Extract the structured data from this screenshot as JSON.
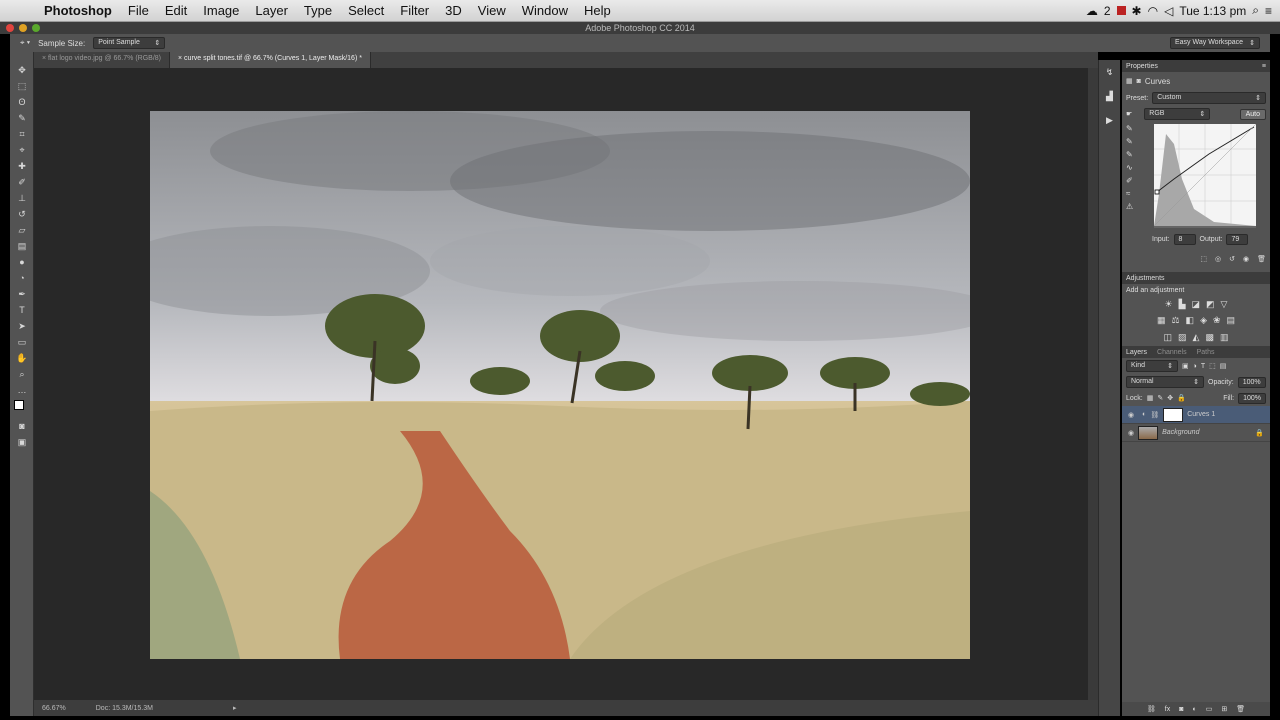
{
  "menubar": {
    "app": "Photoshop",
    "items": [
      "File",
      "Edit",
      "Image",
      "Layer",
      "Type",
      "Select",
      "Filter",
      "3D",
      "View",
      "Window",
      "Help"
    ],
    "clock": "Tue 1:13 pm",
    "badge": "2"
  },
  "window": {
    "title": "Adobe Photoshop CC 2014"
  },
  "options": {
    "sample_label": "Sample Size:",
    "sample_value": "Point Sample",
    "workspace": "Easy Way Workspace"
  },
  "tabs": [
    {
      "label": "flat logo video.jpg @ 66.7% (RGB/8)"
    },
    {
      "label": "curve split tones.tif @ 66.7% (Curves 1, Layer Mask/16) *"
    }
  ],
  "status": {
    "zoom": "66.67%",
    "doc": "Doc: 15.3M/15.3M"
  },
  "properties": {
    "header": "Properties",
    "title": "Curves",
    "preset_label": "Preset:",
    "preset_value": "Custom",
    "channel": "RGB",
    "auto_label": "Auto",
    "input_label": "Input:",
    "input_value": "8",
    "output_label": "Output:",
    "output_value": "79"
  },
  "adjustments": {
    "header": "Adjustments",
    "add_label": "Add an adjustment"
  },
  "layers": {
    "tabs": [
      "Layers",
      "Channels",
      "Paths"
    ],
    "kind": "Kind",
    "blend": "Normal",
    "opacity_label": "Opacity:",
    "opacity_value": "100%",
    "lock_label": "Lock:",
    "fill_label": "Fill:",
    "fill_value": "100%",
    "items": [
      {
        "name": "Curves 1"
      },
      {
        "name": "Background"
      }
    ]
  },
  "colors": {
    "accent": "#4a5c77",
    "panel": "#535353",
    "canvas": "#282828"
  }
}
